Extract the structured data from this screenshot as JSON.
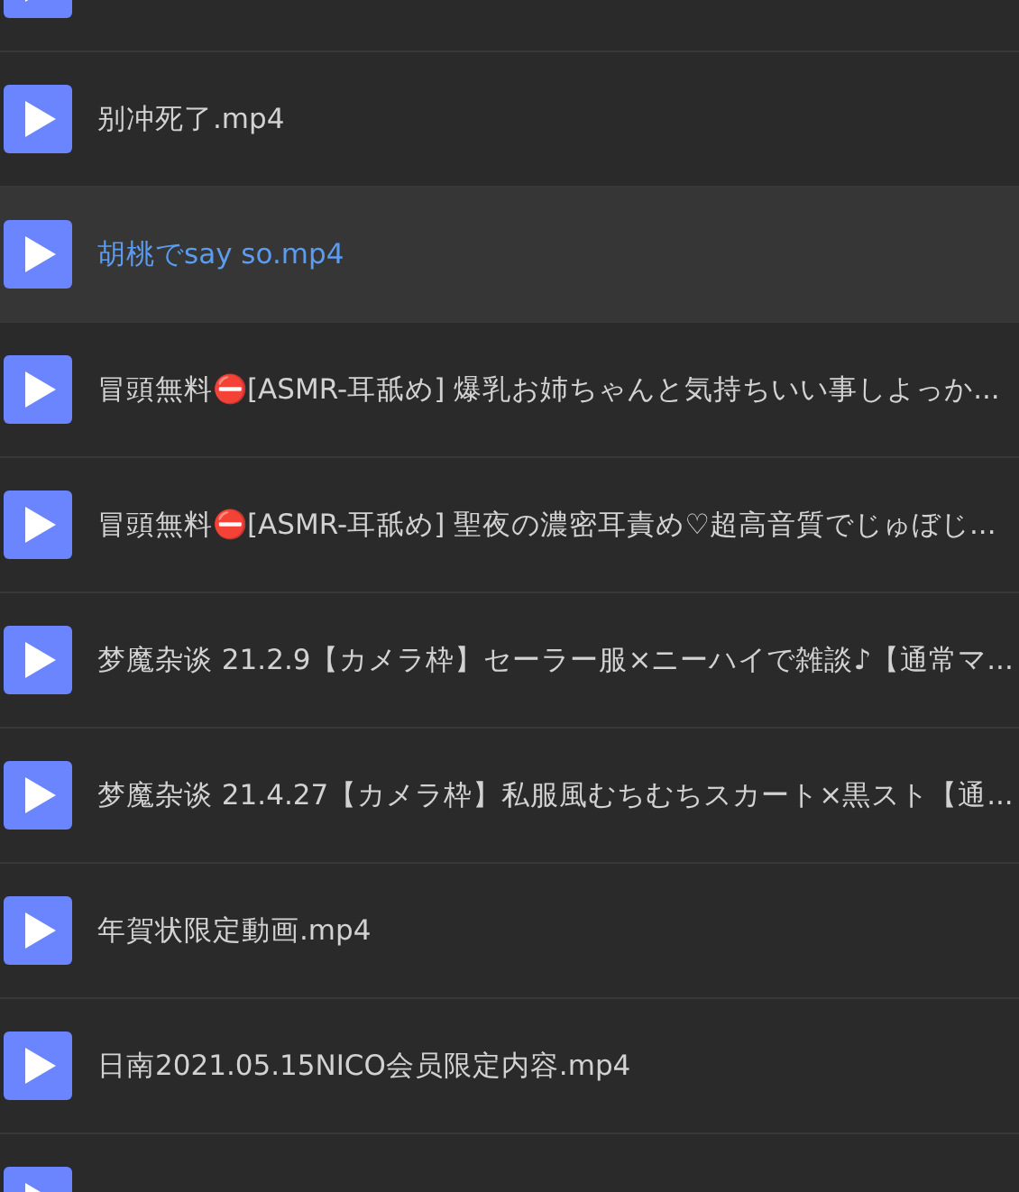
{
  "files": [
    {
      "kind": "partial",
      "selected": false
    },
    {
      "kind": "video",
      "title": "别冲死了.mp4",
      "selected": false
    },
    {
      "kind": "video",
      "title": "胡桃でsay so.mp4",
      "selected": true
    },
    {
      "kind": "video",
      "title": "冒頭無料⛔[ASMR-耳舐め] 爆乳お姉ちゃんと気持ちいい事しよっか...",
      "selected": false
    },
    {
      "kind": "video",
      "title": "冒頭無料⛔[ASMR-耳舐め] 聖夜の濃密耳責め♡超高音質でじゅぼじ...",
      "selected": false
    },
    {
      "kind": "video",
      "title": "梦魔杂谈 21.2.9【カメラ枠】セーラー服×ニーハイで雑談♪【通常マ...",
      "selected": false
    },
    {
      "kind": "video",
      "title": "梦魔杂谈 21.4.27【カメラ枠】私服風むちむちスカート×黒スト【通...",
      "selected": false
    },
    {
      "kind": "video",
      "title": "年賀状限定動画.mp4",
      "selected": false
    },
    {
      "kind": "video",
      "title": "日南2021.05.15NICO会员限定内容.mp4",
      "selected": false
    },
    {
      "kind": "partial",
      "selected": false
    }
  ]
}
